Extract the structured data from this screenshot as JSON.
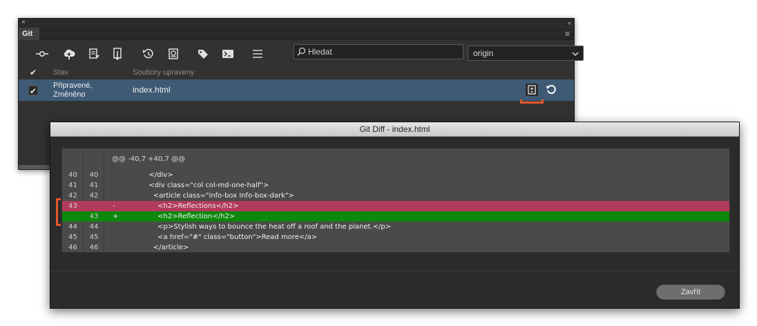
{
  "panel": {
    "close_glyph": "×",
    "collapse_glyph": "‹‹",
    "tab_label": "Git",
    "menu_glyph": "≡"
  },
  "toolbar": {
    "icons": [
      "commit-icon",
      "push-icon",
      "pull-icon",
      "fetch-icon",
      "history-icon",
      "file-history-icon",
      "tag-icon",
      "terminal-icon",
      "more-options-icon"
    ],
    "search": {
      "placeholder": "Hledat",
      "value": ""
    },
    "remote": {
      "selected": "origin"
    }
  },
  "list": {
    "header_check": "✔",
    "columns": {
      "state": "Stav",
      "files": "Soubory upraveny"
    },
    "rows": [
      {
        "checked": true,
        "check_glyph": "✔",
        "state": "Připravené, Změněno",
        "file": "index.html"
      }
    ]
  },
  "diff_dialog": {
    "title": "Git Diff - index.html",
    "hunk_header": "@@ -40,7 +40,7 @@",
    "lines": [
      {
        "old": "40",
        "new": "40",
        "marker": "",
        "type": "context",
        "code": "        </div>"
      },
      {
        "old": "41",
        "new": "41",
        "marker": "",
        "type": "context",
        "code": "        <div class=\"col col-md-one-half\">"
      },
      {
        "old": "42",
        "new": "42",
        "marker": "",
        "type": "context",
        "code": "          <article class=\"info-box info-box-dark\">"
      },
      {
        "old": "43",
        "new": "",
        "marker": "-",
        "type": "removed",
        "code": "            <h2>Reflections</h2>"
      },
      {
        "old": "",
        "new": "43",
        "marker": "+",
        "type": "added",
        "code": "            <h2>Reflection</h2>"
      },
      {
        "old": "44",
        "new": "44",
        "marker": "",
        "type": "context",
        "code": "            <p>Stylish ways to bounce the heat off a roof and the planet.</p>"
      },
      {
        "old": "45",
        "new": "45",
        "marker": "",
        "type": "context",
        "code": "            <a href=\"#\" class=\"button\">Read more</a>"
      },
      {
        "old": "46",
        "new": "46",
        "marker": "",
        "type": "context",
        "code": "          </article>"
      }
    ],
    "close_label": "Zavřít"
  },
  "colors": {
    "removed_line": "#b23a5b",
    "added_line": "#0d870d",
    "selected_row": "#3e5a75",
    "highlight": "#e5582a"
  }
}
